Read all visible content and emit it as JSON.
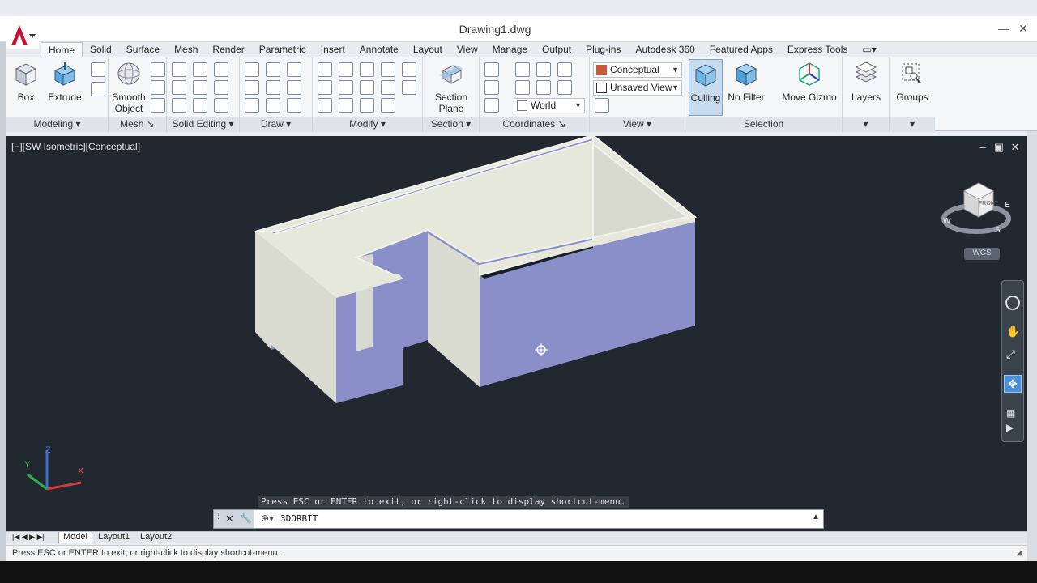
{
  "window": {
    "title": "Drawing1.dwg",
    "minimize": "—",
    "close": "✕"
  },
  "tabs": [
    {
      "label": "Home",
      "active": true
    },
    {
      "label": "Solid"
    },
    {
      "label": "Surface"
    },
    {
      "label": "Mesh"
    },
    {
      "label": "Render"
    },
    {
      "label": "Parametric"
    },
    {
      "label": "Insert"
    },
    {
      "label": "Annotate"
    },
    {
      "label": "Layout"
    },
    {
      "label": "View"
    },
    {
      "label": "Manage"
    },
    {
      "label": "Output"
    },
    {
      "label": "Plug-ins"
    },
    {
      "label": "Autodesk 360"
    },
    {
      "label": "Featured Apps"
    },
    {
      "label": "Express Tools"
    }
  ],
  "ribbon": {
    "modeling": {
      "title": "Modeling",
      "box": "Box",
      "extrude": "Extrude"
    },
    "mesh": {
      "title": "Mesh",
      "smooth": "Smooth",
      "object": "Object"
    },
    "solid_editing": {
      "title": "Solid Editing"
    },
    "draw": {
      "title": "Draw"
    },
    "modify": {
      "title": "Modify"
    },
    "section": {
      "title": "Section",
      "plane1": "Section",
      "plane2": "Plane"
    },
    "coordinates": {
      "title": "Coordinates",
      "world": "World"
    },
    "view": {
      "title": "View",
      "visual_style": "Conceptual",
      "saved_view": "Unsaved View"
    },
    "selection": {
      "title": "Selection",
      "culling": "Culling",
      "no_filter": "No Filter",
      "move_gizmo": "Move Gizmo"
    },
    "layers": {
      "label": "Layers"
    },
    "groups": {
      "label": "Groups"
    }
  },
  "viewport": {
    "label": "[−][SW Isometric][Conceptual]",
    "viewcube_face": "FRONT",
    "compass": {
      "w": "W",
      "s": "S",
      "e": "E"
    },
    "wcs": "WCS",
    "prompt_tip": "Press ESC or ENTER to exit, or right-click to display shortcut-menu.",
    "command": "3DORBIT",
    "axis": {
      "x": "X",
      "y": "Y",
      "z": "Z"
    }
  },
  "layout_tabs": [
    {
      "label": "Model",
      "active": true
    },
    {
      "label": "Layout1"
    },
    {
      "label": "Layout2"
    }
  ],
  "status": {
    "text": "Press ESC or ENTER to exit, or right-click to display shortcut-menu."
  },
  "colors": {
    "viewport_bg": "#212830",
    "wall_face": "#8b8fc9",
    "wall_top": "#e6e8dc",
    "app_red": "#c8102e"
  }
}
